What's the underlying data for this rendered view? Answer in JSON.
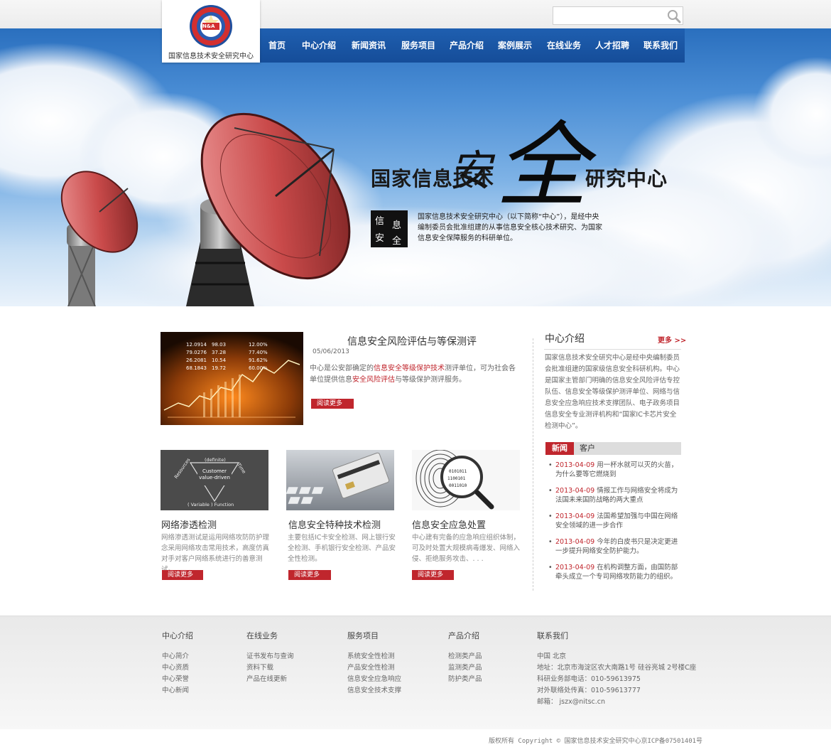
{
  "search": {
    "placeholder": ""
  },
  "logo": {
    "badge_text": "N&A",
    "name": "国家信息技术安全研究中心"
  },
  "nav": [
    {
      "label": "首页"
    },
    {
      "label": "中心介绍"
    },
    {
      "label": "新闻资讯"
    },
    {
      "label": "服务项目"
    },
    {
      "label": "产品介绍"
    },
    {
      "label": "案例展示"
    },
    {
      "label": "在线业务"
    },
    {
      "label": "人才招聘"
    },
    {
      "label": "联系我们"
    }
  ],
  "hero": {
    "char_an": "安",
    "char_quan": "全",
    "left": "国家信息技术",
    "right": "研究中心",
    "seal": [
      "信",
      "息",
      "安",
      "全"
    ],
    "desc": "国家信息技术安全研究中心（以下简称“中心”），是经中央编制委员会批准组建的从事信息安全核心技术研究、为国家信息安全保障服务的科研单位。"
  },
  "featured": {
    "title": "信息安全风险评估与等保测评",
    "date": "05/06/2013",
    "text_1": "中心是公安部确定的",
    "link_1": "信息安全等级保护技术",
    "text_2": "测评单位，可为社会各单位提供信息",
    "link_2": "安全风险评估",
    "text_3": "与等级保护测评服务。",
    "readmore": "阅读更多",
    "chart_numbers": [
      "12.0914",
      "79.0276",
      "26.2081",
      "68.1843",
      "98.03",
      "37.28",
      "10.54",
      "19.72",
      "12.00%",
      "77.40%",
      "91.62%",
      "60.00%"
    ]
  },
  "cards": [
    {
      "title": "网络渗透检测",
      "text": "网络渗透测试是运用网络攻防防护理念采用网络攻击常用技术，高度仿真对手对客户网络系统进行的善意测试。",
      "readmore": "阅读更多",
      "diagram": {
        "top": "(definite)",
        "left": "Resources",
        "right": "Time",
        "center": "Customer value-driven",
        "bottom": "( Variable )  Function"
      }
    },
    {
      "title": "信息安全特种技术检测",
      "text": "主要包括IC卡安全检测、网上银行安全检测、手机银行安全检测、产品安全性检测。",
      "readmore": "阅读更多"
    },
    {
      "title": "信息安全应急处置",
      "text": "中心建有完备的应急响应组织体制，可及时处置大规模病毒爆发、网络入侵、拒绝服务攻击、. . .",
      "readmore": "阅读更多"
    }
  ],
  "side": {
    "title": "中心介绍",
    "more": "更多 >>",
    "text": "国家信息技术安全研究中心是经中央编制委员会批准组建的国家级信息安全科研机构。中心是国家主管部门明确的信息安全风险评估专控队伍、信息安全等级保护测评单位、网络与信息安全应急响应技术支撑团队、电子政务项目信息安全专业测评机构和“国家IC卡芯片安全检测中心”。",
    "tab_news": "新闻",
    "tab_client": "客户",
    "news": [
      {
        "date": "2013-04-09",
        "text": "用一杯水就可以灭的火苗，为什么要等它燃烧到"
      },
      {
        "date": "2013-04-09",
        "text": "情报工作与网络安全将成为法国未来国防战略的两大重点"
      },
      {
        "date": "2013-04-09",
        "text": "法国希望加强与中国在网络安全领域的进一步合作"
      },
      {
        "date": "2013-04-09",
        "text": "今年的白皮书只是决定更进一步提升网络安全防护能力。"
      },
      {
        "date": "2013-04-09",
        "text": "在机构调整方面，由国防部牵头成立一个专司网络攻防能力的组织。"
      }
    ]
  },
  "footer": {
    "cols": [
      {
        "title": "中心介绍",
        "items": [
          "中心简介",
          "中心资质",
          "中心荣誉",
          "中心新闻"
        ]
      },
      {
        "title": "在线业务",
        "items": [
          "证书发布与查询",
          "资料下载",
          "产品在线更新"
        ]
      },
      {
        "title": "服务项目",
        "items": [
          "系统安全性检测",
          "产品安全性检测",
          "信息安全应急响应",
          "信息安全技术支撑"
        ]
      },
      {
        "title": "产品介绍",
        "items": [
          "检测类产品",
          "监测类产品",
          "防护类产品"
        ]
      },
      {
        "title": "联系我们",
        "items": [
          "中国    北京",
          "地址：北京市海淀区农大南路1号 硅谷亮城 2号楼C座",
          "科研业务部电话：010-59613975",
          "对外联络处传真：010-59613777",
          "邮箱： jszx@nitsc.cn"
        ]
      }
    ],
    "copyright": "版权所有 Copyright © 国家信息技术安全研究中心京ICP备07501401号"
  }
}
